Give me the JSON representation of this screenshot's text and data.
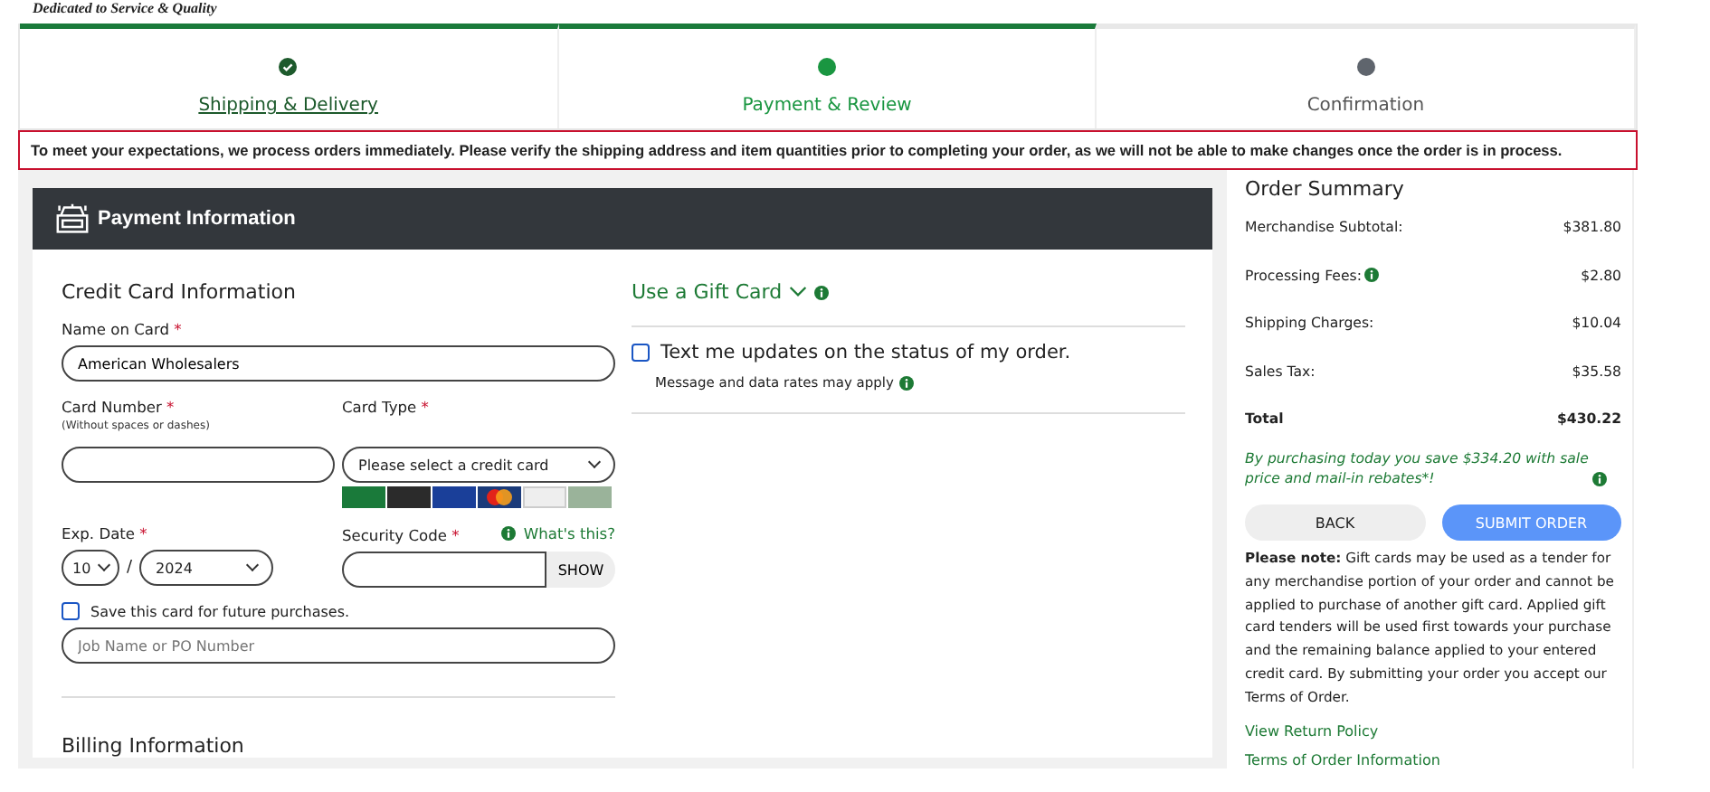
{
  "tagline": "Dedicated to Service & Quality",
  "steps": [
    {
      "label": "Shipping & Delivery",
      "completed": true,
      "selected": false
    },
    {
      "label": "Payment & Review",
      "completed": false,
      "selected": true
    },
    {
      "label": "Confirmation",
      "completed": false,
      "selected": false
    }
  ],
  "notice": "To meet your expectations, we process orders immediately. Please verify the shipping address and item quantities prior to completing your order, as we will not be able to make changes once the order is in process.",
  "required_mark": "*",
  "payment": {
    "title": "Payment Information",
    "credit_card": {
      "heading": "Credit Card Information",
      "name": {
        "label": "Name on Card",
        "value": "American Wholesalers"
      },
      "number": {
        "label": "Card Number",
        "hint": "(Without spaces or dashes)"
      },
      "type": {
        "label": "Card Type",
        "placeholder": "Please select a credit card"
      },
      "exp": {
        "label": "Exp. Date",
        "month": "10",
        "separator": "/",
        "year": "2024"
      },
      "security": {
        "label": "Security Code",
        "help_link": "What's this?",
        "show_button": "SHOW"
      },
      "save_card": {
        "label": "Save this card for future purchases.",
        "checked": false
      },
      "po_placeholder": "Job Name or PO Number"
    },
    "billing_heading": "Billing Information",
    "gift_card_link": "Use a Gift Card",
    "sms": {
      "label": "Text me updates on the status of my order.",
      "checked": false,
      "note": "Message and data rates may apply"
    }
  },
  "summary": {
    "title": "Order Summary",
    "lines": [
      {
        "label": "Merchandise Subtotal:",
        "value": "$381.80",
        "kind": "line"
      },
      {
        "label": "Processing Fees:",
        "value": "$2.80",
        "kind": "info"
      },
      {
        "label": "Shipping Charges:",
        "value": "$10.04",
        "kind": "line"
      },
      {
        "label": "Sales Tax:",
        "value": "$35.58",
        "kind": "line"
      },
      {
        "label": "Total",
        "value": "$430.22",
        "kind": "total"
      }
    ],
    "savings": "By purchasing today you save $334.20 with sale price and mail-in rebates*!",
    "back_button": "BACK",
    "submit_button": "SUBMIT ORDER",
    "note": "**Please note:** Gift cards may be used as a tender for any merchandise portion of your order and cannot be applied to purchase of another gift card. Applied gift card tenders will be used first towards your purchase and the remaining balance applied to your entered credit card. By submitting your order you accept our Terms of Order.",
    "links": [
      "View Return Policy",
      "Terms of Order Information"
    ]
  }
}
